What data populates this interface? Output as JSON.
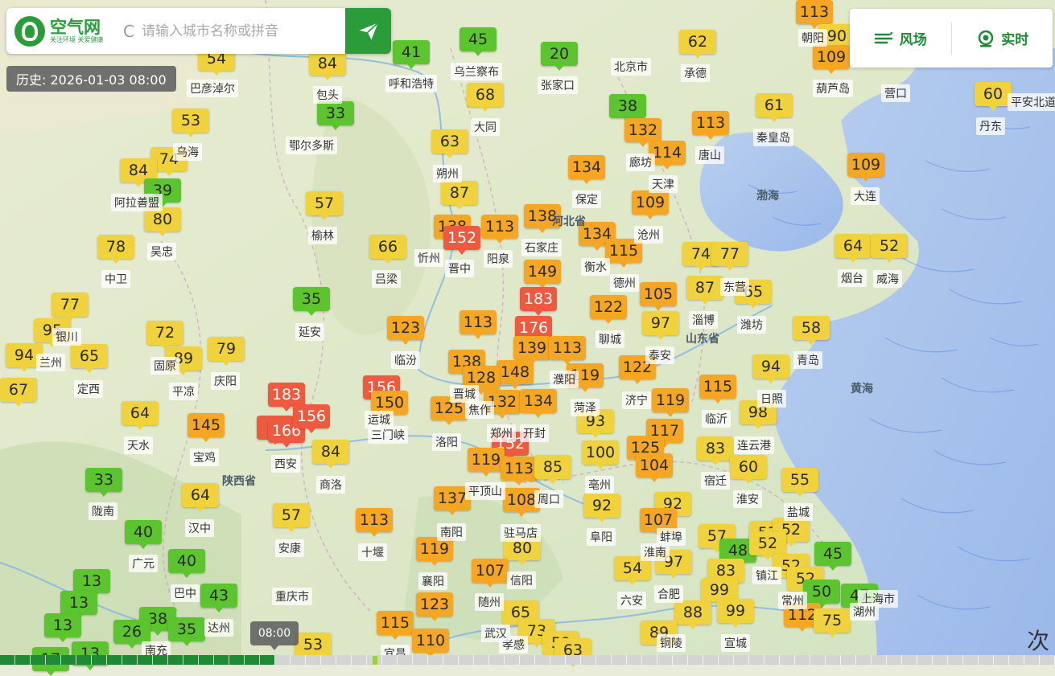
{
  "search": {
    "logo_title": "空气网",
    "logo_slogan": "关注环境 关爱健康",
    "clear_glyph": "C",
    "placeholder": "请输入城市名称或拼音"
  },
  "history_label": "历史: 2026-01-03 08:00",
  "toolbar": {
    "wind_label": "风场",
    "realtime_label": "实时"
  },
  "timeline": {
    "tooltip": "08:00",
    "progress_fraction": 0.26
  },
  "corner_glyph": "次",
  "colors": {
    "good": "#5cc42e",
    "moderate": "#f0d23c",
    "sensitive": "#f5a623",
    "unhealthy": "#ee5a40",
    "brand": "#2a9d3a"
  },
  "aqi_markers": [
    {
      "v": "113",
      "level": "sensitive"
    },
    {
      "v": "90",
      "level": "moderate"
    },
    {
      "v": "109",
      "level": "sensitive"
    },
    {
      "v": "54",
      "level": "moderate"
    },
    {
      "v": "84",
      "level": "moderate"
    },
    {
      "v": "41",
      "level": "good"
    },
    {
      "v": "45",
      "level": "good"
    },
    {
      "v": "20",
      "level": "good"
    },
    {
      "v": "62",
      "level": "moderate"
    },
    {
      "v": "60",
      "level": "moderate"
    },
    {
      "v": "33",
      "level": "good"
    },
    {
      "v": "68",
      "level": "moderate"
    },
    {
      "v": "38",
      "level": "good"
    },
    {
      "v": "132",
      "level": "sensitive"
    },
    {
      "v": "113",
      "level": "sensitive"
    },
    {
      "v": "61",
      "level": "moderate"
    },
    {
      "v": "53",
      "level": "moderate"
    },
    {
      "v": "74",
      "level": "moderate"
    },
    {
      "v": "84",
      "level": "moderate"
    },
    {
      "v": "63",
      "level": "moderate"
    },
    {
      "v": "114",
      "level": "sensitive"
    },
    {
      "v": "109",
      "level": "sensitive"
    },
    {
      "v": "134",
      "level": "sensitive"
    },
    {
      "v": "39",
      "level": "good"
    },
    {
      "v": "57",
      "level": "moderate"
    },
    {
      "v": "87",
      "level": "moderate"
    },
    {
      "v": "109",
      "level": "sensitive"
    },
    {
      "v": "80",
      "level": "moderate"
    },
    {
      "v": "138",
      "level": "sensitive"
    },
    {
      "v": "113",
      "level": "sensitive"
    },
    {
      "v": "138",
      "level": "sensitive"
    },
    {
      "v": "152",
      "level": "unhealthy"
    },
    {
      "v": "134",
      "level": "sensitive"
    },
    {
      "v": "115",
      "level": "sensitive"
    },
    {
      "v": "64",
      "level": "moderate"
    },
    {
      "v": "52",
      "level": "moderate"
    },
    {
      "v": "78",
      "level": "moderate"
    },
    {
      "v": "66",
      "level": "moderate"
    },
    {
      "v": "74",
      "level": "moderate"
    },
    {
      "v": "77",
      "level": "moderate"
    },
    {
      "v": "149",
      "level": "sensitive"
    },
    {
      "v": "87",
      "level": "moderate"
    },
    {
      "v": "65",
      "level": "moderate"
    },
    {
      "v": "105",
      "level": "sensitive"
    },
    {
      "v": "77",
      "level": "moderate"
    },
    {
      "v": "35",
      "level": "good"
    },
    {
      "v": "183",
      "level": "unhealthy"
    },
    {
      "v": "122",
      "level": "sensitive"
    },
    {
      "v": "95",
      "level": "moderate"
    },
    {
      "v": "72",
      "level": "moderate"
    },
    {
      "v": "123",
      "level": "sensitive"
    },
    {
      "v": "113",
      "level": "sensitive"
    },
    {
      "v": "176",
      "level": "unhealthy"
    },
    {
      "v": "97",
      "level": "moderate"
    },
    {
      "v": "58",
      "level": "moderate"
    },
    {
      "v": "79",
      "level": "moderate"
    },
    {
      "v": "94",
      "level": "moderate"
    },
    {
      "v": "65",
      "level": "moderate"
    },
    {
      "v": "89",
      "level": "moderate"
    },
    {
      "v": "139",
      "level": "sensitive"
    },
    {
      "v": "113",
      "level": "sensitive"
    },
    {
      "v": "138",
      "level": "sensitive"
    },
    {
      "v": "148",
      "level": "sensitive"
    },
    {
      "v": "128",
      "level": "sensitive"
    },
    {
      "v": "119",
      "level": "sensitive"
    },
    {
      "v": "122",
      "level": "sensitive"
    },
    {
      "v": "94",
      "level": "moderate"
    },
    {
      "v": "67",
      "level": "moderate"
    },
    {
      "v": "156",
      "level": "unhealthy"
    },
    {
      "v": "183",
      "level": "unhealthy"
    },
    {
      "v": "150",
      "level": "sensitive"
    },
    {
      "v": "115",
      "level": "sensitive"
    },
    {
      "v": "132",
      "level": "sensitive"
    },
    {
      "v": "134",
      "level": "sensitive"
    },
    {
      "v": "119",
      "level": "sensitive"
    },
    {
      "v": "98",
      "level": "moderate"
    },
    {
      "v": "125",
      "level": "sensitive"
    },
    {
      "v": "64",
      "level": "moderate"
    },
    {
      "v": "1",
      "level": "unhealthy"
    },
    {
      "v": "166",
      "level": "unhealthy"
    },
    {
      "v": "156",
      "level": "unhealthy"
    },
    {
      "v": "145",
      "level": "sensitive"
    },
    {
      "v": "93",
      "level": "moderate"
    },
    {
      "v": "117",
      "level": "sensitive"
    },
    {
      "v": "152",
      "level": "unhealthy"
    },
    {
      "v": "100",
      "level": "moderate"
    },
    {
      "v": "125",
      "level": "sensitive"
    },
    {
      "v": "83",
      "level": "moderate"
    },
    {
      "v": "84",
      "level": "moderate"
    },
    {
      "v": "119",
      "level": "sensitive"
    },
    {
      "v": "113",
      "level": "sensitive"
    },
    {
      "v": "85",
      "level": "moderate"
    },
    {
      "v": "104",
      "level": "sensitive"
    },
    {
      "v": "60",
      "level": "moderate"
    },
    {
      "v": "55",
      "level": "moderate"
    },
    {
      "v": "33",
      "level": "good"
    },
    {
      "v": "64",
      "level": "moderate"
    },
    {
      "v": "137",
      "level": "sensitive"
    },
    {
      "v": "108",
      "level": "sensitive"
    },
    {
      "v": "92",
      "level": "moderate"
    },
    {
      "v": "92",
      "level": "moderate"
    },
    {
      "v": "57",
      "level": "moderate"
    },
    {
      "v": "113",
      "level": "sensitive"
    },
    {
      "v": "107",
      "level": "sensitive"
    },
    {
      "v": "40",
      "level": "good"
    },
    {
      "v": "57",
      "level": "moderate"
    },
    {
      "v": "53",
      "level": "moderate"
    },
    {
      "v": "52",
      "level": "moderate"
    },
    {
      "v": "119",
      "level": "sensitive"
    },
    {
      "v": "80",
      "level": "moderate"
    },
    {
      "v": "48",
      "level": "good"
    },
    {
      "v": "52",
      "level": "moderate"
    },
    {
      "v": "45",
      "level": "good"
    },
    {
      "v": "40",
      "level": "good"
    },
    {
      "v": "54",
      "level": "moderate"
    },
    {
      "v": "97",
      "level": "moderate"
    },
    {
      "v": "83",
      "level": "moderate"
    },
    {
      "v": "52",
      "level": "moderate"
    },
    {
      "v": "107",
      "level": "sensitive"
    },
    {
      "v": "13",
      "level": "good"
    },
    {
      "v": "43",
      "level": "good"
    },
    {
      "v": "99",
      "level": "moderate"
    },
    {
      "v": "52",
      "level": "moderate"
    },
    {
      "v": "13",
      "level": "good"
    },
    {
      "v": "50",
      "level": "good"
    },
    {
      "v": "47",
      "level": "good"
    },
    {
      "v": "123",
      "level": "sensitive"
    },
    {
      "v": "65",
      "level": "moderate"
    },
    {
      "v": "88",
      "level": "moderate"
    },
    {
      "v": "99",
      "level": "moderate"
    },
    {
      "v": "38",
      "level": "good"
    },
    {
      "v": "13",
      "level": "good"
    },
    {
      "v": "115",
      "level": "sensitive"
    },
    {
      "v": "73",
      "level": "moderate"
    },
    {
      "v": "89",
      "level": "moderate"
    },
    {
      "v": "112",
      "level": "sensitive"
    },
    {
      "v": "75",
      "level": "moderate"
    },
    {
      "v": "26",
      "level": "good"
    },
    {
      "v": "35",
      "level": "good"
    },
    {
      "v": "53",
      "level": "moderate"
    },
    {
      "v": "110",
      "level": "sensitive"
    },
    {
      "v": "59",
      "level": "moderate"
    },
    {
      "v": "63",
      "level": "moderate"
    },
    {
      "v": "13",
      "level": "good"
    },
    {
      "v": "17",
      "level": "good"
    }
  ],
  "city_labels": [
    "朝阳",
    "葫芦岛",
    "营口",
    "巴彦淖尔",
    "包头",
    "呼和浩特",
    "乌兰察布",
    "张家口",
    "北京市",
    "承德",
    "丹东",
    "鄂尔多斯",
    "大同",
    "秦皇岛",
    "唐山",
    "廊坊",
    "天津",
    "乌海",
    "朔州",
    "大连",
    "阿拉善盟",
    "保定",
    "榆林",
    "石家庄",
    "沧州",
    "吴忠",
    "忻州",
    "晋中",
    "阳泉",
    "衡水",
    "德州",
    "烟台",
    "威海",
    "中卫",
    "吕梁",
    "淄博",
    "潍坊",
    "东营",
    "延安",
    "聊城",
    "泰安",
    "临汾",
    "青岛",
    "银川",
    "兰州",
    "定西",
    "平凉",
    "庆阳",
    "固原",
    "济宁",
    "日照",
    "菏泽",
    "临沂",
    "运城",
    "三门峡",
    "焦作",
    "开封",
    "晋城",
    "濮阳",
    "洛阳",
    "郑州",
    "天水",
    "宝鸡",
    "西安",
    "商洛",
    "连云港",
    "宿迁",
    "淮安",
    "盐城",
    "亳州",
    "平顶山",
    "周口",
    "阜阳",
    "驻马店",
    "汉中",
    "陇南",
    "安康",
    "十堰",
    "南阳",
    "信阳",
    "蚌埠",
    "淮南",
    "镇江",
    "常州",
    "合肥",
    "六安",
    "襄阳",
    "随州",
    "巴中",
    "达州",
    "广元",
    "重庆市",
    "孝感",
    "南充",
    "宜昌",
    "铜陵",
    "宣城",
    "武汉",
    "上海市",
    "平安北道",
    "湖州"
  ],
  "region_labels": [
    "河北省",
    "山东省",
    "陕西省",
    "渤海",
    "黄海"
  ]
}
